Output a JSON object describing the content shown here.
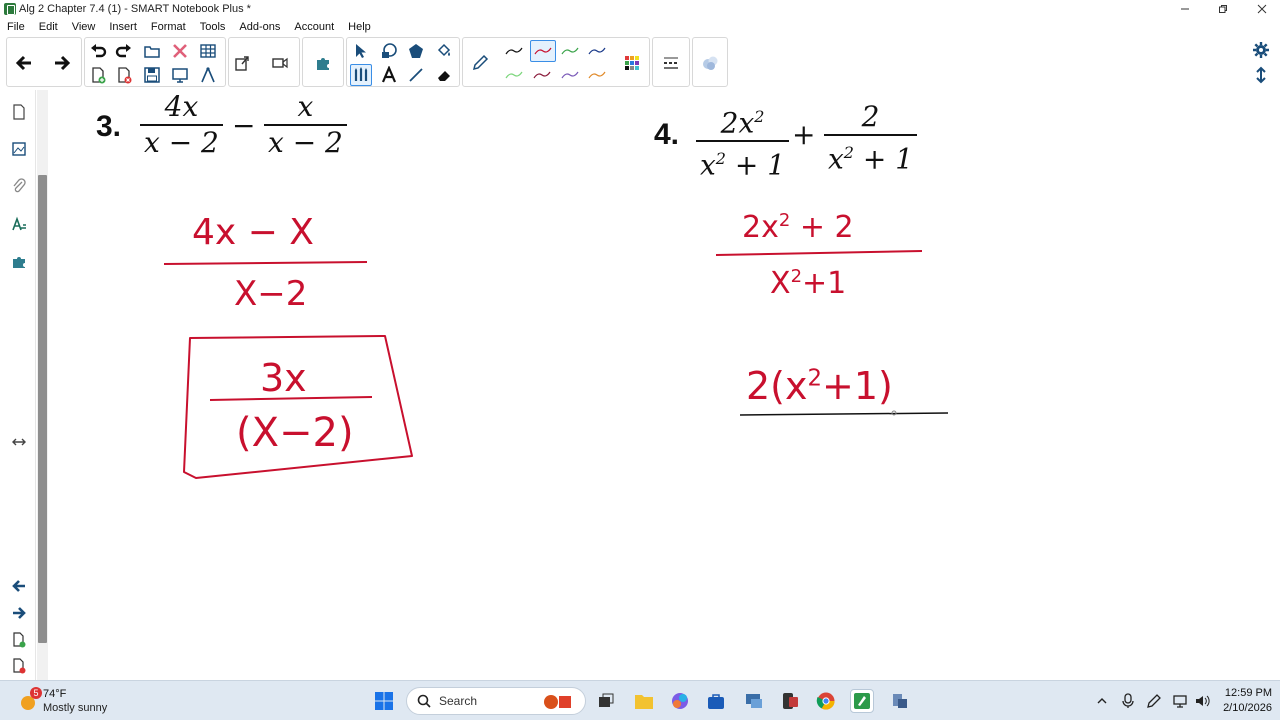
{
  "window": {
    "title": "Alg 2 Chapter 7.4 (1) - SMART Notebook Plus *"
  },
  "menu": [
    "File",
    "Edit",
    "View",
    "Insert",
    "Format",
    "Tools",
    "Add-ons",
    "Account",
    "Help"
  ],
  "problems": {
    "p3": {
      "number": "3.",
      "frac1_num": "4x",
      "frac1_den": "x − 2",
      "operator": "−",
      "frac2_num": "x",
      "frac2_den": "x − 2"
    },
    "p4": {
      "number": "4.",
      "frac1_num_base": "2x",
      "frac1_num_exp": "2",
      "frac1_den_base": "x",
      "frac1_den_exp": "2",
      "frac1_den_rest": " + 1",
      "operator": "+",
      "frac2_num": "2",
      "frac2_den_base": "x",
      "frac2_den_exp": "2",
      "frac2_den_rest": " + 1"
    }
  },
  "ink": {
    "p3_step1_num": "4x − X",
    "p3_step1_den": "X−2",
    "p3_answer_num": "3x",
    "p3_answer_den": "(X−2)",
    "p4_step1_num_a": "2x",
    "p4_step1_num_exp": "2",
    "p4_step1_num_b": " + 2",
    "p4_step1_den_a": "X",
    "p4_step1_den_exp": "2",
    "p4_step1_den_b": "+1",
    "p4_step2_a": "2(x",
    "p4_step2_exp": "2",
    "p4_step2_b": "+1)"
  },
  "colors": {
    "ink": "#c8102e",
    "accent": "#3a8ee6",
    "taskbar": "#dfe8f2"
  },
  "taskbar": {
    "weather_temp": "74°F",
    "weather_desc": "Mostly sunny",
    "weather_badge": "5",
    "search_label": "Search",
    "time": "12:59 PM",
    "date": "2/10/2026"
  }
}
